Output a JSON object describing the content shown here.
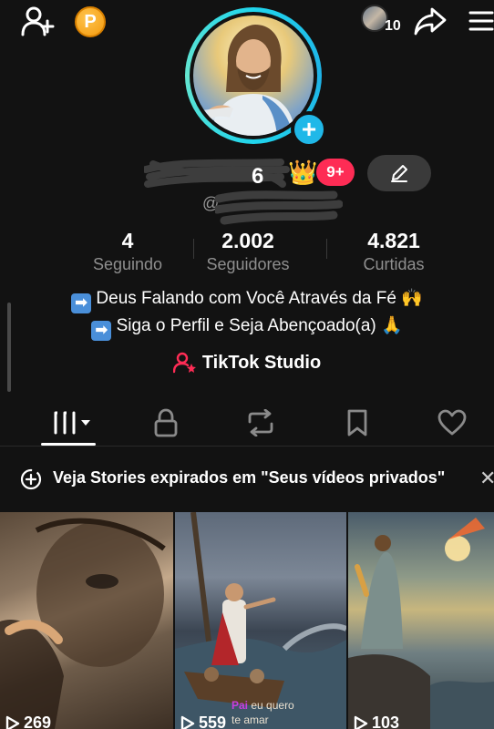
{
  "header": {
    "coin_label": "P",
    "story_count": "10"
  },
  "profile": {
    "badge": "9+",
    "username_visible": "@",
    "crown": "👑"
  },
  "stats": [
    {
      "value": "4",
      "label": "Seguindo"
    },
    {
      "value": "2.002",
      "label": "Seguidores"
    },
    {
      "value": "4.821",
      "label": "Curtidas"
    }
  ],
  "bio": {
    "line1": "Deus Falando com Você Através da Fé 🙌",
    "line2": "Siga o Perfil e Seja Abençoado(a) 🙏",
    "arrow": "➡"
  },
  "studio": {
    "label": "TikTok Studio"
  },
  "tabs": [
    "videos-grid",
    "private",
    "reposts",
    "saved",
    "liked"
  ],
  "banner": {
    "text": "Veja Stories expirados em \"Seus vídeos privados\"",
    "close": "✕"
  },
  "videos": [
    {
      "views": "269"
    },
    {
      "views": "559",
      "overlay_line1": "eu quero",
      "overlay_pink": "Pai",
      "overlay_line2": "te amar"
    },
    {
      "views": "103"
    }
  ],
  "colors": {
    "background": "#121212",
    "accent_red": "#fe2c55",
    "ring_cyan": "#20d5ec",
    "coin_orange": "#f39a0e",
    "muted_text": "#8f8f8f"
  }
}
